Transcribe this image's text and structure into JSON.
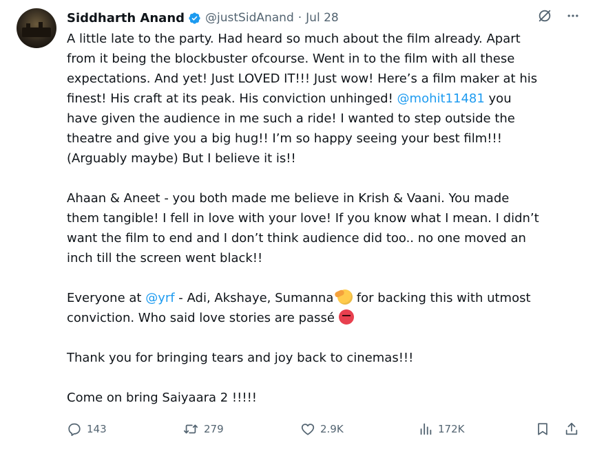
{
  "tweet": {
    "author_name": "Siddharth Anand",
    "handle": "@justSidAnand",
    "separator": "·",
    "date": "Jul 28",
    "paragraphs": [
      [
        [
          {
            "t": "A little late to the party. Had heard so much about the film already. Apart"
          }
        ],
        [
          {
            "t": "from it being the blockbuster ofcourse. Went in to the film with all these"
          }
        ],
        [
          {
            "t": "expectations. And yet! Just LOVED IT!!!  Just wow! Here’s a film maker at his"
          }
        ],
        [
          {
            "t": "finest! His craft at its peak. His conviction unhinged! "
          },
          {
            "t": "@mohit11481",
            "m": true
          },
          {
            "t": "  you"
          }
        ],
        [
          {
            "t": "have given the audience in me such a ride! I wanted to step outside the"
          }
        ],
        [
          {
            "t": "theatre and give you a big hug!! I’m so happy seeing your best film!!!"
          }
        ],
        [
          {
            "t": "(Arguably maybe) But I believe it is!!"
          }
        ]
      ],
      [
        [
          {
            "t": "Ahaan & Aneet - you both made me believe in Krish & Vaani. You made"
          }
        ],
        [
          {
            "t": "them tangible! I fell in love with your love! If you know what I mean. I didn’t"
          }
        ],
        [
          {
            "t": "want the film to end and I don’t think audience did too.. no one moved an"
          }
        ],
        [
          {
            "t": "inch till the screen went black!!"
          }
        ]
      ],
      [
        [
          {
            "t": "Everyone at "
          },
          {
            "t": "@yrf",
            "m": true
          },
          {
            "t": " - Adi, Akshaye, Sumanna "
          },
          {
            "e": "saluting-face-emoji"
          },
          {
            "t": " for backing this with utmost"
          }
        ],
        [
          {
            "t": "conviction. Who said love stories are passé "
          },
          {
            "e": "angry-face-emoji"
          }
        ]
      ],
      [
        [
          {
            "t": "Thank you for bringing tears and joy back to cinemas!!!"
          }
        ]
      ],
      [
        [
          {
            "t": "Come on bring Saiyaara 2 !!!!!"
          }
        ]
      ]
    ],
    "actions": {
      "replies": "143",
      "reposts": "279",
      "likes": "2.9K",
      "views": "172K"
    }
  },
  "colors": {
    "text": "#0f1419",
    "secondary": "#536471",
    "link": "#1d9bf0",
    "verified": "#1d9bf0"
  },
  "icons": {
    "verified": "verified-badge-icon",
    "grok": "grok-icon",
    "more": "more-options-icon",
    "reply": "reply-icon",
    "repost": "repost-icon",
    "like": "like-icon",
    "views": "views-icon",
    "bookmark": "bookmark-icon",
    "share": "share-icon"
  }
}
